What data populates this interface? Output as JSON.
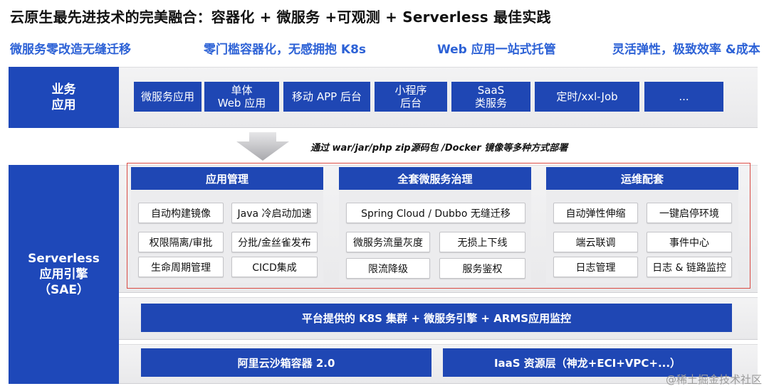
{
  "title": "云原生最先进技术的完美融合：容器化 + 微服务 +可观测 + Serverless 最佳实践",
  "taglines": [
    "微服务零改造无缝迁移",
    "零门槛容器化，无感拥抱 K8s",
    "Web 应用一站式托管",
    "灵活弹性，极致效率 &成本"
  ],
  "business": {
    "label": "业务\n应用",
    "apps": [
      "微服务应用",
      "单体\nWeb 应用",
      "移动 APP 后台",
      "小程序\n后台",
      "SaaS\n类服务",
      "定时/xxl-Job",
      "..."
    ]
  },
  "deploy_note": "通过 war/jar/php zip源码包 /Docker 镜像等多种方式部署",
  "sae": {
    "label": "Serverless\n应用引擎\n（SAE）",
    "columns": [
      {
        "title": "应用管理",
        "items": [
          "自动构建镜像",
          "Java 冷启动加速",
          "权限隔离/审批",
          "分批/金丝雀发布",
          "生命周期管理",
          "CICD集成"
        ]
      },
      {
        "title": "全套微服务治理",
        "items": [
          "Spring Cloud / Dubbo 无缝迁移",
          "微服务流量灰度",
          "无损上下线",
          "限流降级",
          "服务鉴权"
        ]
      },
      {
        "title": "运维配套",
        "items": [
          "自动弹性伸缩",
          "一键启停环境",
          "端云联调",
          "事件中心",
          "日志管理",
          "日志 & 链路监控"
        ]
      }
    ],
    "platform_bar": "平台提供的 K8S 集群 + 微服务引擎 + ARMS应用监控",
    "sandbox_bar": "阿里云沙箱容器 2.0",
    "iaas_bar": "IaaS 资源层（神龙+ECI+VPC+...）"
  },
  "watermark": "@稀土掘金技术社区",
  "colors": {
    "primary_blue": "#1f47b4",
    "tagline_blue": "#2d62d6",
    "frame_red": "#d94a43"
  }
}
